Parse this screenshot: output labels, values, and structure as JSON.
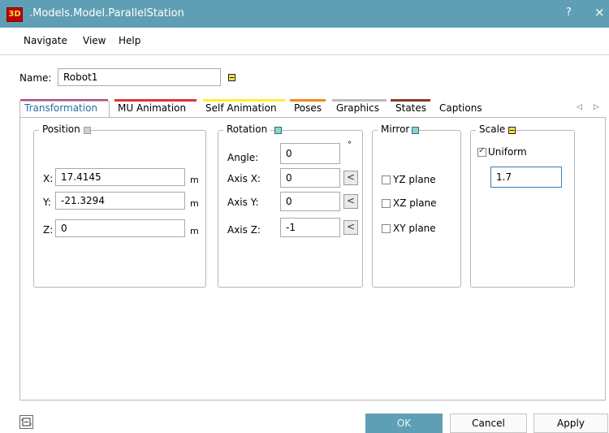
{
  "window": {
    "title": ".Models.Model.ParallelStation",
    "icon_text": "3D",
    "help_glyph": "?",
    "close_glyph": "×"
  },
  "menu": {
    "items": [
      "Navigate",
      "View",
      "Help"
    ]
  },
  "name_field": {
    "label": "Name:",
    "value": "Robot1"
  },
  "tabs": [
    {
      "label": "Transformation",
      "color": "#c0457a",
      "active": true
    },
    {
      "label": "MU Animation",
      "color": "#e53030"
    },
    {
      "label": "Self Animation",
      "color": "#ffee33"
    },
    {
      "label": "Poses",
      "color": "#f08a1c"
    },
    {
      "label": "Graphics",
      "color": "#bcbcbc"
    },
    {
      "label": "States",
      "color": "#8b3a2a"
    },
    {
      "label": "Captions",
      "color": ""
    }
  ],
  "tab_scroll": {
    "left": "◁",
    "right": "▷"
  },
  "position": {
    "title": "Position",
    "x_label": "X:",
    "x_value": "17.4145",
    "x_unit": "m",
    "y_label": "Y:",
    "y_value": "-21.3294",
    "y_unit": "m",
    "z_label": "Z:",
    "z_value": "0",
    "z_unit": "m"
  },
  "rotation": {
    "title": "Rotation",
    "angle_label": "Angle:",
    "angle_value": "0",
    "angle_unit": "°",
    "axis_x_label": "Axis X:",
    "axis_x_value": "0",
    "axis_y_label": "Axis Y:",
    "axis_y_value": "0",
    "axis_z_label": "Axis Z:",
    "axis_z_value": "-1",
    "pick_button_label": "<"
  },
  "mirror": {
    "title": "Mirror",
    "yz_label": "YZ plane",
    "yz_checked": false,
    "xz_label": "XZ plane",
    "xz_checked": false,
    "xy_label": "XY plane",
    "xy_checked": false
  },
  "scale": {
    "title": "Scale",
    "uniform_label": "Uniform",
    "uniform_checked": true,
    "value": "1.7"
  },
  "footer": {
    "ok_label": "OK",
    "cancel_label": "Cancel",
    "apply_label": "Apply"
  }
}
